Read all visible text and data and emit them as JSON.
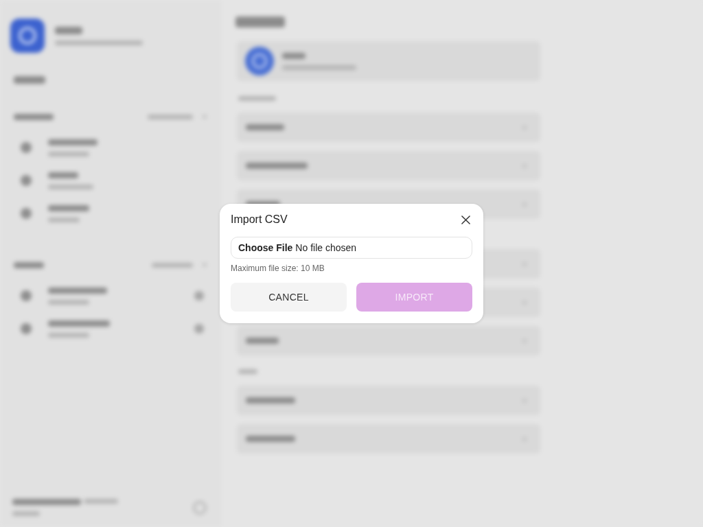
{
  "dialog": {
    "title": "Import CSV",
    "file_field": {
      "button_label": "Choose File",
      "status": "No file chosen"
    },
    "hint": "Maximum file size: 10 MB",
    "buttons": [
      {
        "label": "CANCEL",
        "kind": "secondary",
        "disabled": false
      },
      {
        "label": "IMPORT",
        "kind": "primary",
        "disabled": true
      }
    ]
  }
}
